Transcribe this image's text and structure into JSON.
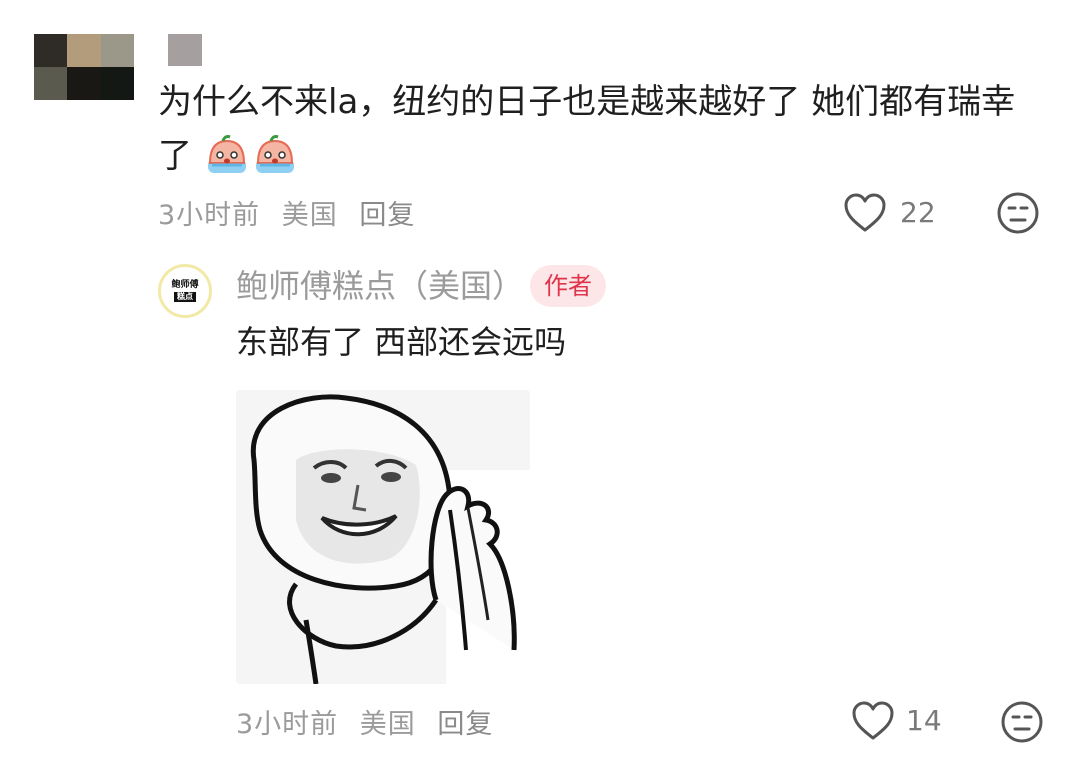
{
  "top_comment": {
    "text_line1": "为什么不来la，纽约的日子也是越来越好了 她们都有瑞幸",
    "text_line2": "了",
    "emojis": [
      "crying-emoji",
      "crying-emoji"
    ],
    "time": "3小时前",
    "location": "美国",
    "reply_label": "回复",
    "likes": "22",
    "avatar_colors": [
      "#2f2c27",
      "#b29c7c",
      "#9b9889",
      "#5a5a4f",
      "#191814",
      "#131815"
    ],
    "name_color": "#a69f9f"
  },
  "reply": {
    "avatar_logo_top": "鲍师傅",
    "avatar_logo_bottom": "糕点",
    "name": "鲍师傅糕点（美国）",
    "badge": "作者",
    "text": "东部有了 西部还会远吗",
    "sticker": "smiling-face-meme-sticker",
    "time": "3小时前",
    "location": "美国",
    "reply_label": "回复",
    "likes": "14"
  },
  "colors": {
    "badge_text": "#e0344b",
    "badge_bg": "#fde6e8",
    "meta_text": "#9b9b9b"
  }
}
